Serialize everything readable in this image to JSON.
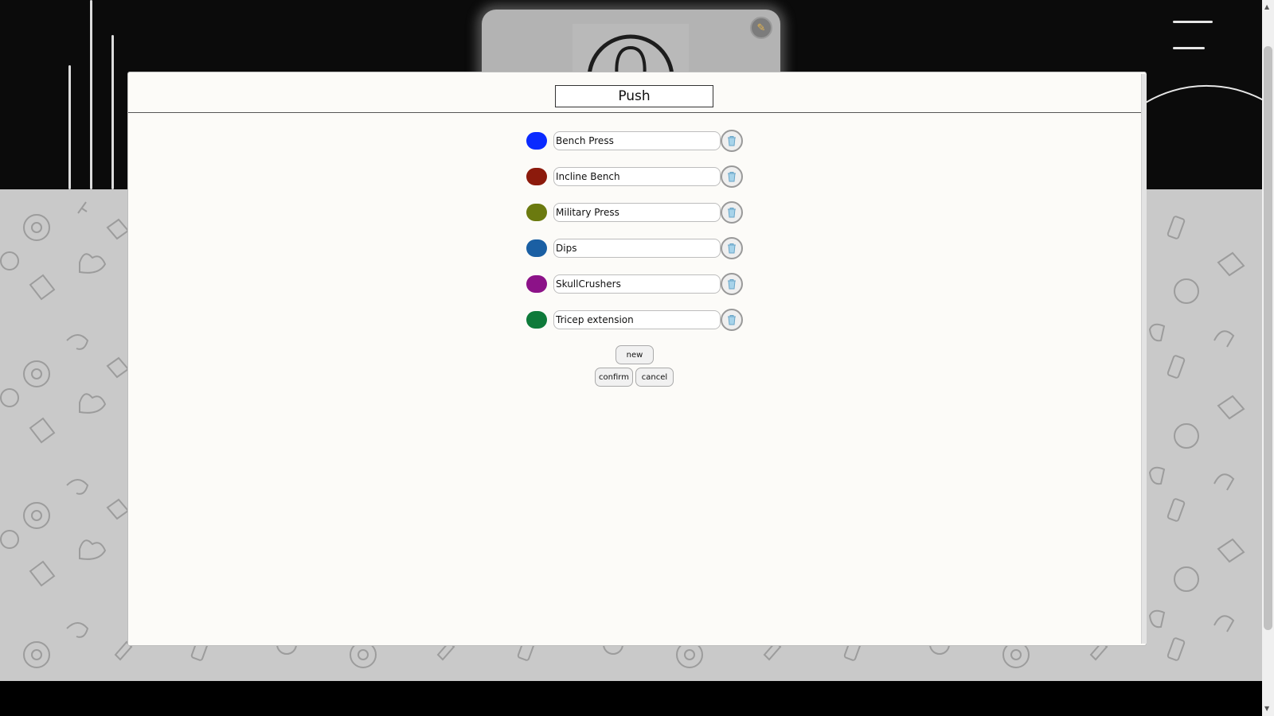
{
  "workout": {
    "title": "Push"
  },
  "exercises": [
    {
      "name": "Bench Press",
      "color": "#0a2aff"
    },
    {
      "name": "Incline Bench",
      "color": "#8c1a0c"
    },
    {
      "name": "Military Press",
      "color": "#6b7a0f"
    },
    {
      "name": "Dips",
      "color": "#1a5fa3"
    },
    {
      "name": "SkullCrushers",
      "color": "#8c1288"
    },
    {
      "name": "Tricep extension",
      "color": "#0e7a3a"
    }
  ],
  "buttons": {
    "new": "new",
    "confirm": "confirm",
    "cancel": "cancel"
  },
  "icons": {
    "delete": "trash-icon",
    "edit": "pencil-icon",
    "menu": "hamburger-icon",
    "profile": "user-avatar-icon"
  }
}
